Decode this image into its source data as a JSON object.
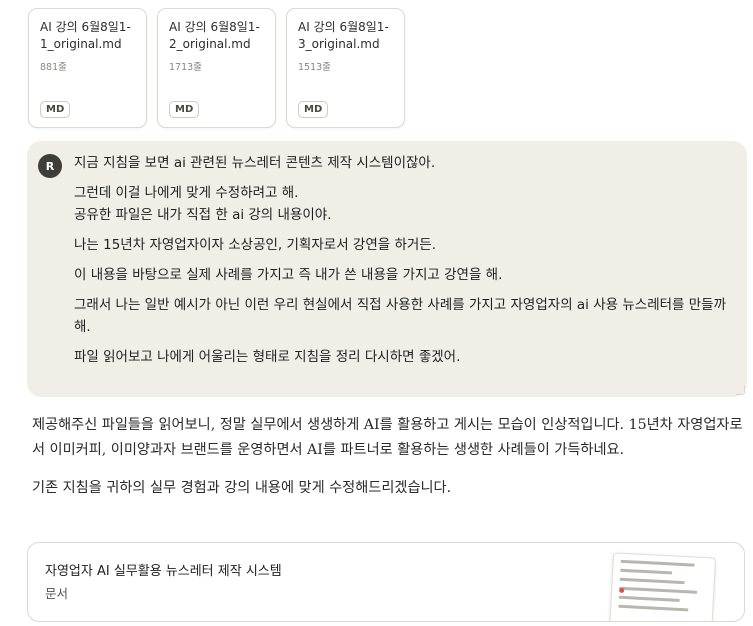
{
  "files": [
    {
      "name": "AI 강의 6월8일1-1_original.md",
      "lines": "881줄",
      "badge": "MD"
    },
    {
      "name": "AI 강의 6월8일1-2_original.md",
      "lines": "1713줄",
      "badge": "MD"
    },
    {
      "name": "AI 강의 6월8일1-3_original.md",
      "lines": "1513줄",
      "badge": "MD"
    }
  ],
  "user": {
    "avatar_initial": "R",
    "paragraphs": [
      "지금 지침을 보면 ai 관련된 뉴스레터 콘텐츠 제작 시스템이잖아.",
      "그런데 이걸 나에게 맞게 수정하려고 해.",
      "공유한 파일은 내가 직접 한 ai 강의 내용이야.",
      "나는 15년차 자영업자이자 소상공인, 기획자로서 강연을 하거든.",
      "이 내용을 바탕으로 실제 사례를 가지고 즉 내가 쓴 내용을 가지고 강연을 해.",
      "그래서 나는 일반 예시가 아닌 이런 우리 현실에서 직접 사용한 사례를 가지고 자영업자의 ai 사용 뉴스레터를 만들까 해.",
      "파일 읽어보고 나에게 어울리는 형태로 지침을 정리 다시하면 좋겠어."
    ]
  },
  "assistant": {
    "paragraphs": [
      "제공해주신 파일들을 읽어보니, 정말 실무에서 생생하게 AI를 활용하고 게시는 모습이 인상적입니다. 15년차 자영업자로서 이미커피, 이미양과자 브랜드를 운영하면서 AI를 파트너로 활용하는 생생한 사례들이 가득하네요.",
      "기존 지침을 귀하의 실무 경험과 강의 내용에 맞게 수정해드리겠습니다."
    ]
  },
  "artifact": {
    "title": "자영업자 AI 실무활용 뉴스레터 제작 시스템",
    "type": "문서"
  }
}
